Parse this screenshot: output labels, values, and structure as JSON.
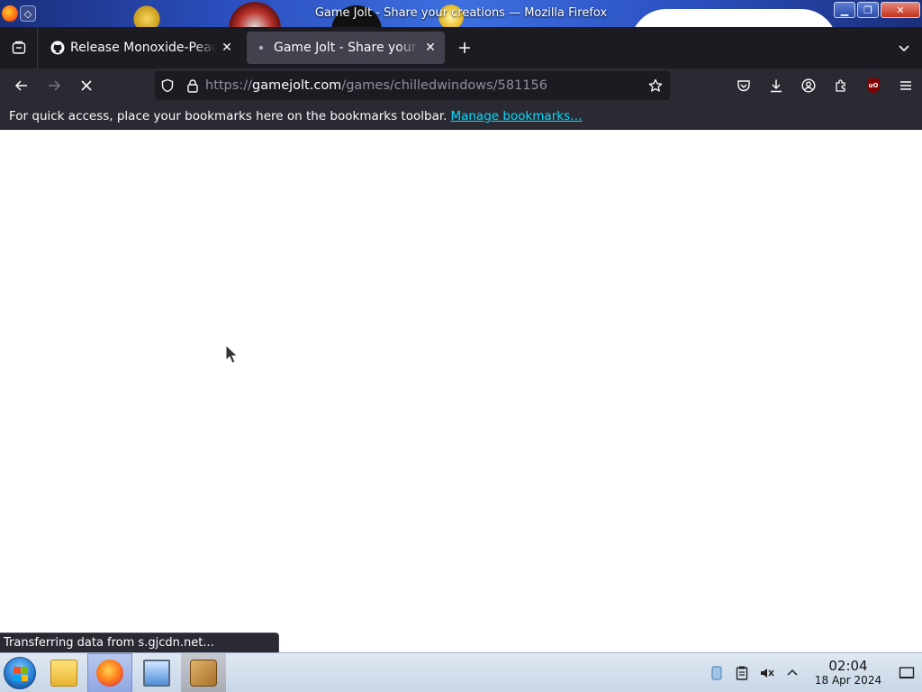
{
  "window": {
    "title": "Game Jolt - Share your creations — Mozilla Firefox"
  },
  "tabs": [
    {
      "title": "Release Monoxide-Peace",
      "favicon": "github-icon",
      "active": false
    },
    {
      "title": "Game Jolt - Share your creations",
      "favicon": "loading-dot-icon",
      "active": true
    }
  ],
  "navbar": {
    "url_prefix": "https://",
    "url_host": "gamejolt.com",
    "url_path": "/games/chilledwindows/581156"
  },
  "bookmarks_bar": {
    "message": "For quick access, place your bookmarks here on the bookmarks toolbar.",
    "link": "Manage bookmarks…"
  },
  "status": {
    "text": "Transferring data from s.gjcdn.net..."
  },
  "taskbar": {
    "apps": [
      "file-manager-icon",
      "firefox-icon",
      "system-monitor-icon",
      "package-box-icon"
    ],
    "time": "02:04",
    "date": "18 Apr 2024"
  },
  "colors": {
    "toolbar_bg": "#2b2a33",
    "tabstrip_bg": "#1c1b22",
    "link": "#00ddff",
    "titlebar": "#2a4fbf"
  }
}
